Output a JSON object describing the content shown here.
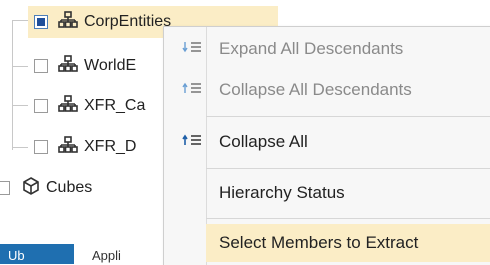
{
  "tree": {
    "nodes": [
      {
        "label": "CorpEntities",
        "checked": true,
        "icon": "hierarchy-icon"
      },
      {
        "label": "WorldE",
        "checked": false,
        "icon": "hierarchy-icon"
      },
      {
        "label": "XFR_Ca",
        "checked": false,
        "icon": "hierarchy-icon"
      },
      {
        "label": "XFR_D",
        "checked": false,
        "icon": "hierarchy-icon"
      },
      {
        "label": "Cubes",
        "checked": false,
        "icon": "cube-icon"
      }
    ]
  },
  "menu": {
    "items": [
      {
        "label": "Expand All Descendants",
        "icon": "expand-descendants-icon",
        "enabled": false
      },
      {
        "label": "Collapse All Descendants",
        "icon": "collapse-descendants-icon",
        "enabled": false
      },
      {
        "label": "Collapse All",
        "icon": "collapse-all-icon",
        "enabled": true
      },
      {
        "label": "Hierarchy Status",
        "icon": "",
        "enabled": true
      },
      {
        "label": "Select Members to Extract",
        "icon": "",
        "enabled": true,
        "highlighted": true
      }
    ]
  },
  "bottom_tabs": {
    "tab1": "Ub",
    "tab2": "Appli"
  },
  "colors": {
    "highlight": "#fbedc6",
    "checked_fill": "#1f4f9a",
    "tab_active": "#1f6fb0"
  }
}
